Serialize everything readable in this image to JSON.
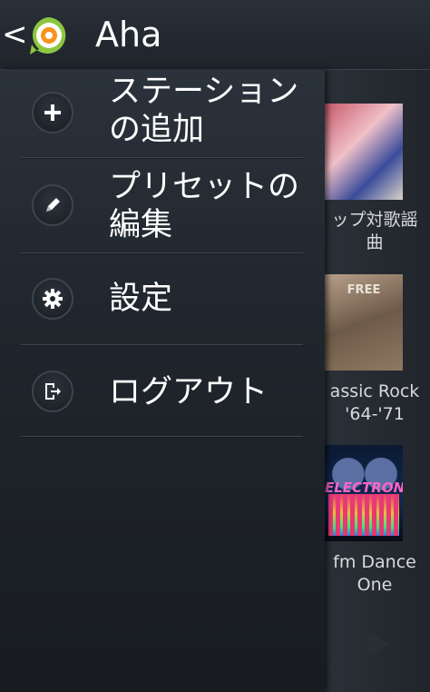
{
  "header": {
    "back_glyph": "<",
    "title": "Aha",
    "logo_icon": "aha-logo-icon",
    "colors": {
      "logo_green": "#8cc63f",
      "logo_orange": "#f7931e"
    }
  },
  "drawer": {
    "items": [
      {
        "icon": "plus-icon",
        "line1": "ステーション",
        "line2": "の追加"
      },
      {
        "icon": "pencil-icon",
        "line1": "プリセットの",
        "line2": "編集"
      },
      {
        "icon": "gear-icon",
        "line1": "設定",
        "line2": ""
      },
      {
        "icon": "logout-icon",
        "line1": "ログアウト",
        "line2": ""
      }
    ]
  },
  "stations": [
    {
      "line1": "ップ対歌謡",
      "line2": "曲",
      "art_text": ""
    },
    {
      "line1": "assic Rock",
      "line2": "'64-'71",
      "art_text": "FREE"
    },
    {
      "line1": "fm Dance",
      "line2": "One",
      "art_text": "ELECTRONIC"
    }
  ]
}
